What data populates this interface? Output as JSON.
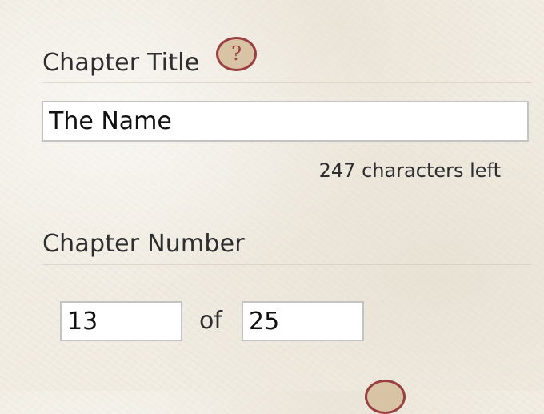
{
  "chapter_title": {
    "label": "Chapter Title",
    "help_icon": "?",
    "value": "The Name",
    "characters_left": "247 characters left"
  },
  "chapter_number": {
    "label": "Chapter Number",
    "current_value": "13",
    "of_label": "of",
    "total_value": "25"
  },
  "colors": {
    "accent": "#9b4040",
    "help_fill": "#d8c4a5",
    "page_background": "#f1ede3",
    "input_border": "#c4c4c4",
    "text": "#2e2e2e"
  }
}
